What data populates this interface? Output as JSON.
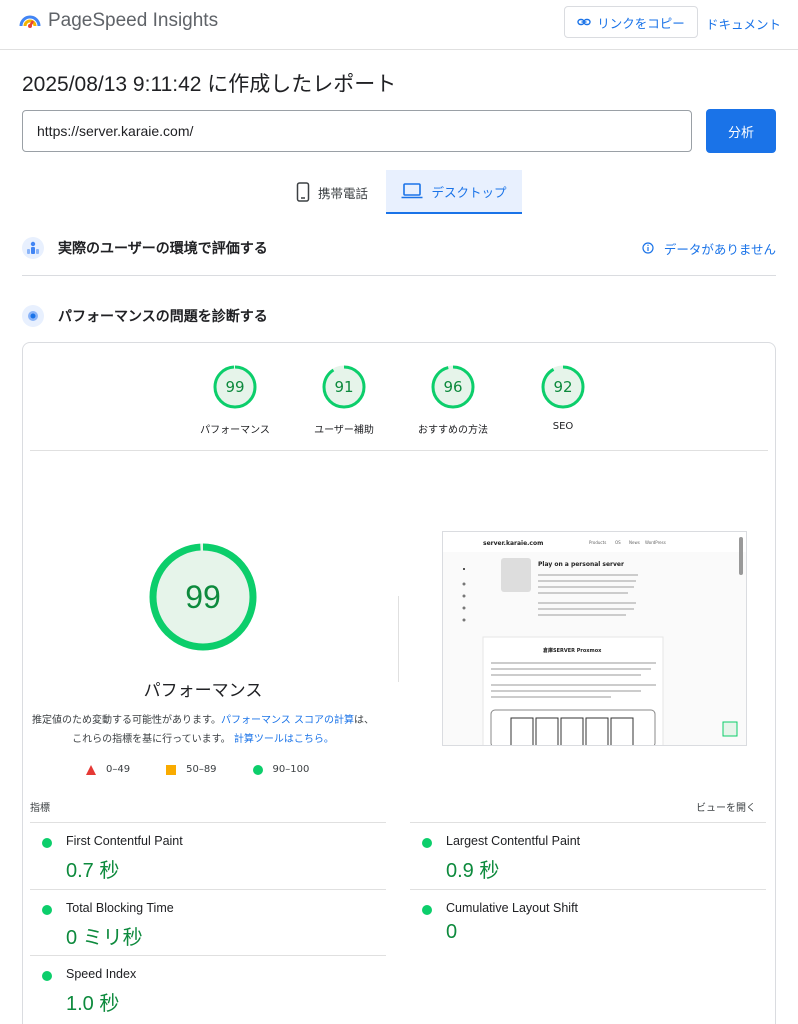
{
  "app": {
    "title": "PageSpeed Insights",
    "copy_link": "リンクをコピー",
    "docs": "ドキュメント"
  },
  "report": {
    "title": "2025/08/13 9:11:42 に作成したレポート"
  },
  "url_input": {
    "value": "https://server.karaie.com/"
  },
  "analyze_button": "分析",
  "tabs": [
    {
      "label": "携帯電話"
    },
    {
      "label": "デスクトップ"
    }
  ],
  "field_section": {
    "title": "実際のユーザーの環境で評価する",
    "no_data": "データがありません"
  },
  "diagnose_section": {
    "title": "パフォーマンスの問題を診断する"
  },
  "scores": [
    {
      "value": "99",
      "label": "パフォーマンス"
    },
    {
      "value": "91",
      "label": "ユーザー補助"
    },
    {
      "value": "96",
      "label": "おすすめの方法"
    },
    {
      "value": "92",
      "label": "SEO"
    }
  ],
  "main_score": {
    "value": "99",
    "label": "パフォーマンス"
  },
  "note": {
    "text1": "推定値のため変動する可能性があります。",
    "link1": "パフォーマンス スコアの計算",
    "text2": "は、",
    "text3": "これらの指標を基に行っています。",
    "link2": "計算ツールはこちら。"
  },
  "legend": [
    {
      "label": "0–49"
    },
    {
      "label": "50–89"
    },
    {
      "label": "90–100"
    }
  ],
  "metrics_header": {
    "title": "指標",
    "toggle": "ビューを開く"
  },
  "metrics": [
    {
      "name": "First Contentful Paint",
      "value": "0.7 秒"
    },
    {
      "name": "Largest Contentful Paint",
      "value": "0.9 秒"
    },
    {
      "name": "Total Blocking Time",
      "value": "0 ミリ秒"
    },
    {
      "name": "Cumulative Layout Shift",
      "value": "0"
    },
    {
      "name": "Speed Index",
      "value": "1.0 秒"
    }
  ],
  "preview": {
    "site_name": "server.karaie.com",
    "nav": [
      "Products",
      "OS",
      "News",
      "WordPress"
    ],
    "hero_title": "Play on a personal server",
    "section_title": "倉庫SERVER Proxmox"
  },
  "colors": {
    "accent": "#1a73e8",
    "pass": "#0cce6b",
    "pass_text": "#0d8a3d",
    "average": "#f9ab00",
    "fail": "#e53935"
  }
}
